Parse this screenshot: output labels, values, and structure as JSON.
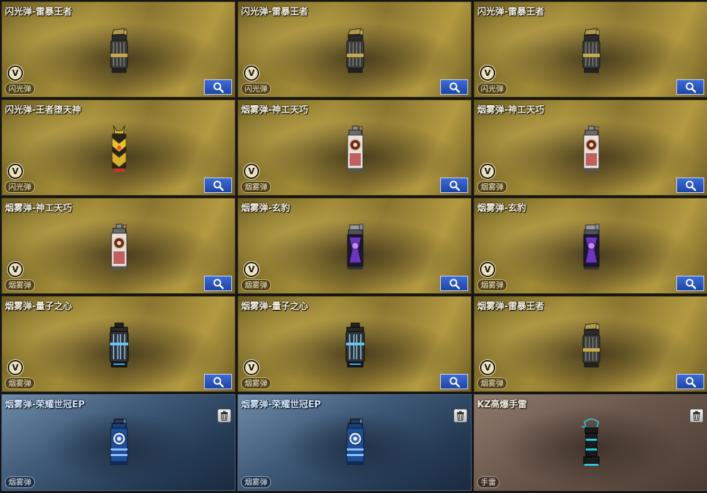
{
  "cards": [
    {
      "title": "闪光弹-雷暴王者",
      "tag": "闪光弹",
      "theme": "gold",
      "item": "thunder",
      "action": "search"
    },
    {
      "title": "闪光弹-雷暴王者",
      "tag": "闪光弹",
      "theme": "gold",
      "item": "thunder",
      "action": "search"
    },
    {
      "title": "闪光弹-雷暴王者",
      "tag": "闪光弹",
      "theme": "gold",
      "item": "thunder",
      "action": "search"
    },
    {
      "title": "闪光弹-王者堕天神",
      "tag": "闪光弹",
      "theme": "gold",
      "item": "fallen",
      "action": "search"
    },
    {
      "title": "烟雾弹-神工天巧",
      "tag": "烟雾弹",
      "theme": "gold",
      "item": "craft",
      "action": "search"
    },
    {
      "title": "烟雾弹-神工天巧",
      "tag": "烟雾弹",
      "theme": "gold",
      "item": "craft",
      "action": "search"
    },
    {
      "title": "烟雾弹-神工天巧",
      "tag": "烟雾弹",
      "theme": "gold",
      "item": "craft",
      "action": "search"
    },
    {
      "title": "烟雾弹-玄豹",
      "tag": "烟雾弹",
      "theme": "gold",
      "item": "panther",
      "action": "search"
    },
    {
      "title": "烟雾弹-玄豹",
      "tag": "烟雾弹",
      "theme": "gold",
      "item": "panther",
      "action": "search"
    },
    {
      "title": "烟雾弹-量子之心",
      "tag": "烟雾弹",
      "theme": "gold",
      "item": "quantum",
      "action": "search"
    },
    {
      "title": "烟雾弹-量子之心",
      "tag": "烟雾弹",
      "theme": "gold",
      "item": "quantum",
      "action": "search"
    },
    {
      "title": "烟雾弹-雷暴王者",
      "tag": "烟雾弹",
      "theme": "gold",
      "item": "thunder",
      "action": "search"
    },
    {
      "title": "烟雾弹-荣耀世冠EP",
      "tag": "烟雾弹",
      "theme": "blue",
      "item": "glory",
      "action": "trash"
    },
    {
      "title": "烟雾弹-荣耀世冠EP",
      "tag": "烟雾弹",
      "theme": "blue",
      "item": "glory",
      "action": "trash"
    },
    {
      "title": "KZ高爆手雷",
      "tag": "手雷",
      "theme": "brown",
      "item": "kz",
      "action": "trash"
    }
  ],
  "badge_letter": "V",
  "icons": {
    "search": "magnifier-icon",
    "trash": "trash-icon",
    "vip": "v-badge-icon"
  }
}
